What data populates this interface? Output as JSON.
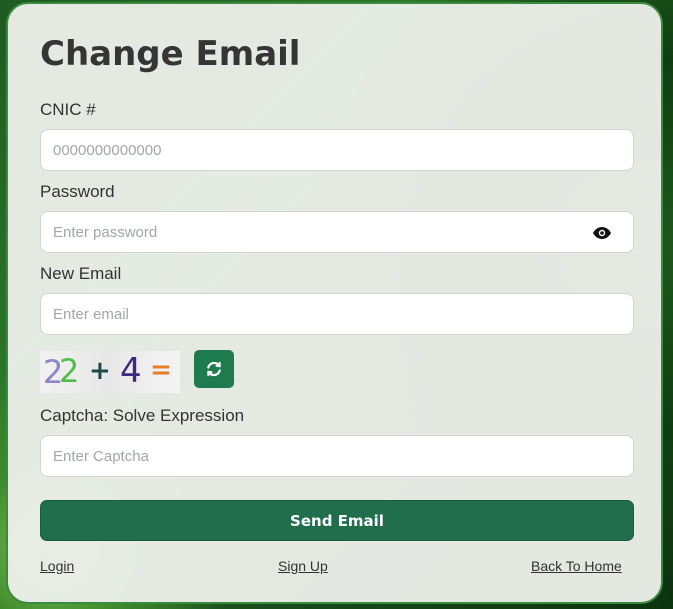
{
  "form": {
    "title": "Change Email",
    "cnic": {
      "label": "CNIC #",
      "placeholder": "0000000000000"
    },
    "password": {
      "label": "Password",
      "placeholder": "Enter password"
    },
    "new_email": {
      "label": "New Email",
      "placeholder": "Enter email"
    },
    "captcha": {
      "label": "Captcha: Solve Expression",
      "placeholder": "Enter Captcha",
      "expression": [
        "2",
        "2",
        "+",
        "4",
        "="
      ]
    },
    "send_label": "Send Email"
  },
  "links": {
    "login": "Login",
    "signup": "Sign Up",
    "home": "Back To Home"
  },
  "colors": {
    "primary": "#206e4d",
    "card_border": "#3a8a3f"
  },
  "icons": {
    "password_toggle": "eye-icon",
    "captcha_refresh": "refresh-icon"
  }
}
